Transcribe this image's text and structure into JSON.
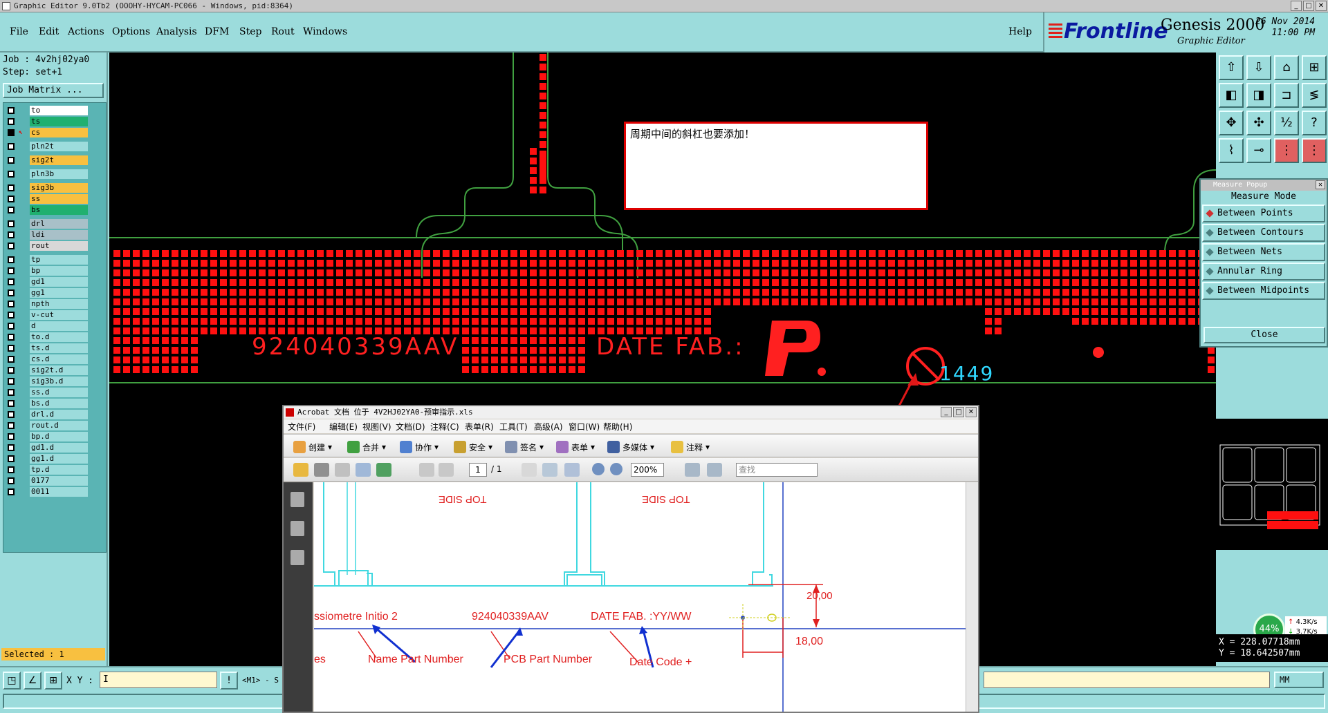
{
  "window": {
    "title": "Graphic Editor 9.0Tb2 (OOOHY-HYCAM-PC066 - Windows, pid:8364)",
    "buttons": [
      "_",
      "□",
      "✕"
    ]
  },
  "menu": [
    "File",
    "Edit",
    "Actions",
    "Options",
    "Analysis",
    "DFM",
    "Step",
    "Rout",
    "Windows"
  ],
  "help": "Help",
  "brand": {
    "logo": "Frontline",
    "product": "Genesis 2000",
    "subtitle": "Graphic Editor",
    "date": "26 Nov 2014",
    "time": "11:00 PM"
  },
  "job": {
    "job_label": "Job : 4v2hj02ya0",
    "step_label": "Step: set+1",
    "matrix_button": "Job Matrix ..."
  },
  "layers": [
    {
      "name": "to",
      "color": "#ffffff"
    },
    {
      "name": "ts",
      "color": "#20b070"
    },
    {
      "name": "cs",
      "color": "#f8c040"
    },
    {
      "name": "pln2t",
      "color": "#9cdcdc"
    },
    {
      "name": "sig2t",
      "color": "#f8c040"
    },
    {
      "name": "pln3b",
      "color": "#9cdcdc"
    },
    {
      "name": "sig3b",
      "color": "#f8c040"
    },
    {
      "name": "ss",
      "color": "#f8c040"
    },
    {
      "name": "bs",
      "color": "#20b070"
    },
    {
      "name": "drl",
      "color": "#a8c0c8"
    },
    {
      "name": "ldi",
      "color": "#a8c0c8"
    },
    {
      "name": "rout",
      "color": "#d8d8d8"
    },
    {
      "name": "tp",
      "color": "#9cdcdc"
    },
    {
      "name": "bp",
      "color": "#9cdcdc"
    },
    {
      "name": "gd1",
      "color": "#9cdcdc"
    },
    {
      "name": "gg1",
      "color": "#9cdcdc"
    },
    {
      "name": "npth",
      "color": "#9cdcdc"
    },
    {
      "name": "v-cut",
      "color": "#9cdcdc"
    },
    {
      "name": "d",
      "color": "#9cdcdc"
    },
    {
      "name": "to.d",
      "color": "#9cdcdc"
    },
    {
      "name": "ts.d",
      "color": "#9cdcdc"
    },
    {
      "name": "cs.d",
      "color": "#9cdcdc"
    },
    {
      "name": "sig2t.d",
      "color": "#9cdcdc"
    },
    {
      "name": "sig3b.d",
      "color": "#9cdcdc"
    },
    {
      "name": "ss.d",
      "color": "#9cdcdc"
    },
    {
      "name": "bs.d",
      "color": "#9cdcdc"
    },
    {
      "name": "drl.d",
      "color": "#9cdcdc"
    },
    {
      "name": "rout.d",
      "color": "#9cdcdc"
    },
    {
      "name": "bp.d",
      "color": "#9cdcdc"
    },
    {
      "name": "gd1.d",
      "color": "#9cdcdc"
    },
    {
      "name": "gg1.d",
      "color": "#9cdcdc"
    },
    {
      "name": "tp.d",
      "color": "#9cdcdc"
    },
    {
      "name": "0177",
      "color": "#9cdcdc"
    },
    {
      "name": "0011",
      "color": "#9cdcdc"
    }
  ],
  "selected": "Selected : 1",
  "canvas": {
    "note": "周期中间的斜杠也要添加！",
    "part_number": "924040339AAV",
    "date_fab": "DATE FAB.:",
    "date_code": "1449",
    "pb_symbol": "Pb"
  },
  "measure_popup": {
    "title": "Measure Popup",
    "mode_label": "Measure Mode",
    "options": [
      "Between Points",
      "Between Contours",
      "Between Nets",
      "Annular Ring",
      "Between Midpoints"
    ],
    "close": "Close"
  },
  "coords": {
    "x": "X  = 228.07718mm",
    "y": "Y  = 18.642507mm"
  },
  "net_monitor": {
    "percent": "44%",
    "up": "4.3K/s",
    "down": "3.7K/s"
  },
  "bottom": {
    "xy_label": "X Y :",
    "hint": "<M1> - S",
    "unit": "MM"
  },
  "acrobat": {
    "title": "Acrobat 文档 位于 4V2HJ02YA0-预审指示.xls",
    "menu": [
      "文件(F)",
      "编辑(E)",
      "视图(V)",
      "文档(D)",
      "注释(C)",
      "表单(R)",
      "工具(T)",
      "高级(A)",
      "窗口(W)",
      "帮助(H)"
    ],
    "toolbar": [
      "创建",
      "合并",
      "协作",
      "安全",
      "签名",
      "表单",
      "多媒体",
      "注释"
    ],
    "page_number": "1",
    "page_count": "/ 1",
    "zoom": "200%",
    "find_placeholder": "查找",
    "page": {
      "top_side_1": "TOP SIDE",
      "top_side_2": "TOP SIDE",
      "label_left": "ssiometre Initio 2",
      "part_number": "924040339AAV",
      "date_fab": "DATE FAB. :YY/WW",
      "dim_1": "20,00",
      "dim_2": "18,00",
      "ann_1": "es",
      "ann_2": "Name Part Number",
      "ann_3": "PCB Part Number",
      "ann_4": "Date Code +"
    }
  }
}
